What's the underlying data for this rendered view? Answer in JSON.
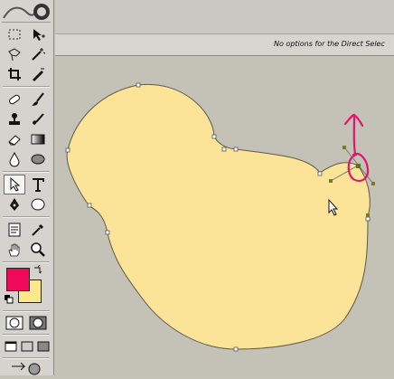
{
  "options_bar": {
    "message": "No options for the Direct Selec"
  },
  "colors": {
    "foreground": "#f00a5a",
    "background": "#fde98c",
    "shape_fill": "#fbe497",
    "shape_stroke": "#5e5a45",
    "annotation": "#e0186a",
    "canvas": "#c4c1b7",
    "selected_anchor": "#7a7a22"
  },
  "toolbox": {
    "selected_tool": "direct-selection-tool"
  },
  "annotation": {
    "type": "hand-drawn circle and upward arrow around selected anchor point"
  }
}
